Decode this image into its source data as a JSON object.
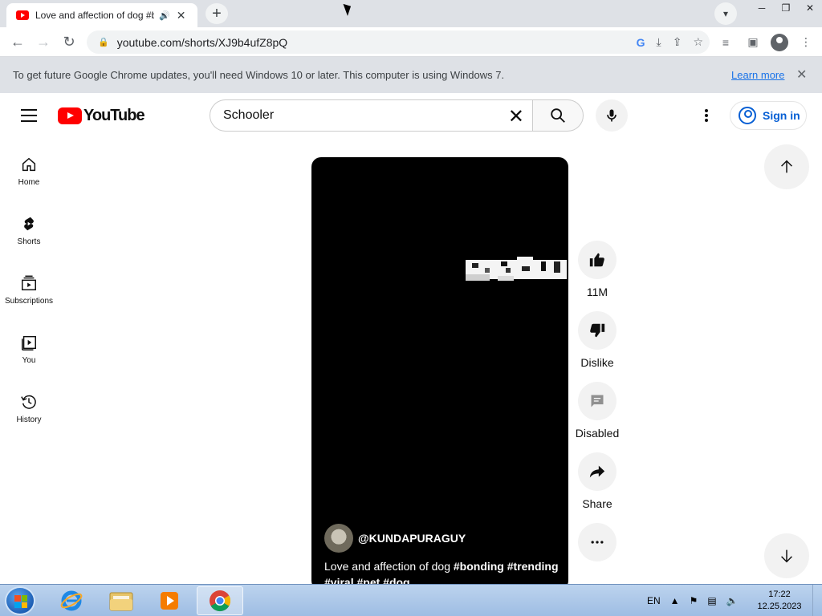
{
  "browser": {
    "tab": {
      "title": "Love and affection of dog #b"
    },
    "address": {
      "url": "youtube.com/shorts/XJ9b4ufZ8pQ"
    },
    "infobar": {
      "message": "To get future Google Chrome updates, you'll need Windows 10 or later. This computer is using Windows 7.",
      "link": "Learn more"
    }
  },
  "youtube": {
    "logo_text": "YouTube",
    "search": {
      "query": "Schooler"
    },
    "sign_in": "Sign in",
    "sidebar": [
      {
        "label": "Home",
        "icon": "home-icon"
      },
      {
        "label": "Shorts",
        "icon": "shorts-icon"
      },
      {
        "label": "Subscriptions",
        "icon": "subscriptions-icon"
      },
      {
        "label": "You",
        "icon": "you-icon"
      },
      {
        "label": "History",
        "icon": "history-icon"
      }
    ],
    "short": {
      "channel": "@KUNDAPURAGUY",
      "title_plain": "Love and affection of dog ",
      "hashtags_line1": "#bonding #trending",
      "hashtags_line2": "#viral #pet #dog"
    },
    "actions": {
      "like_count": "11M",
      "dislike": "Dislike",
      "comments": "Disabled",
      "share": "Share"
    }
  },
  "taskbar": {
    "language": "EN",
    "time": "17:22",
    "date": "12.25.2023"
  },
  "colors": {
    "youtube_red": "#ff0000",
    "link_blue": "#065fd4",
    "chrome_bar": "#dee1e6"
  }
}
